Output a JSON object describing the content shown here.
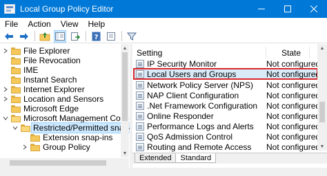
{
  "window": {
    "title": "Local Group Policy Editor"
  },
  "menu": [
    "File",
    "Action",
    "View",
    "Help"
  ],
  "tree": {
    "items": [
      {
        "label": "File Explorer",
        "expandable": true
      },
      {
        "label": "File Revocation",
        "expandable": false
      },
      {
        "label": "IME",
        "expandable": false
      },
      {
        "label": "Instant Search",
        "expandable": false
      },
      {
        "label": "Internet Explorer",
        "expandable": true
      },
      {
        "label": "Location and Sensors",
        "expandable": true
      },
      {
        "label": "Microsoft Edge",
        "expandable": false
      },
      {
        "label": "Microsoft Management Console",
        "expandable": true,
        "expanded": true
      },
      {
        "label": "Restricted/Permitted snap-ins",
        "expandable": true,
        "expanded": true,
        "selected": true
      },
      {
        "label": "Extension snap-ins",
        "expandable": false
      },
      {
        "label": "Group Policy",
        "expandable": true
      }
    ]
  },
  "list": {
    "columns": {
      "setting": "Setting",
      "state": "State"
    },
    "rows": [
      {
        "setting": "IP Security Monitor",
        "state": "Not configured"
      },
      {
        "setting": "Local Users and Groups",
        "state": "Not configured",
        "highlight": true
      },
      {
        "setting": "Network Policy Server (NPS)",
        "state": "Not configured"
      },
      {
        "setting": "NAP Client Configuration",
        "state": "Not configured"
      },
      {
        "setting": ".Net Framework Configuration",
        "state": "Not configured"
      },
      {
        "setting": "Online Responder",
        "state": "Not configured"
      },
      {
        "setting": "Performance Logs and Alerts",
        "state": "Not configured"
      },
      {
        "setting": "QoS Admission Control",
        "state": "Not configured"
      },
      {
        "setting": "Routing and Remote Access",
        "state": "Not configured"
      }
    ]
  },
  "tabs": [
    "Extended",
    "Standard"
  ],
  "active_tab": "Standard",
  "colors": {
    "titlebar": "#0078d7",
    "highlight_border": "#d9262a",
    "selection": "#cce8ff"
  },
  "icons": [
    "back-arrow-icon",
    "forward-arrow-icon",
    "up-folder-icon",
    "show-hide-tree-icon",
    "export-list-icon",
    "help-icon",
    "properties-icon",
    "filter-icon"
  ]
}
